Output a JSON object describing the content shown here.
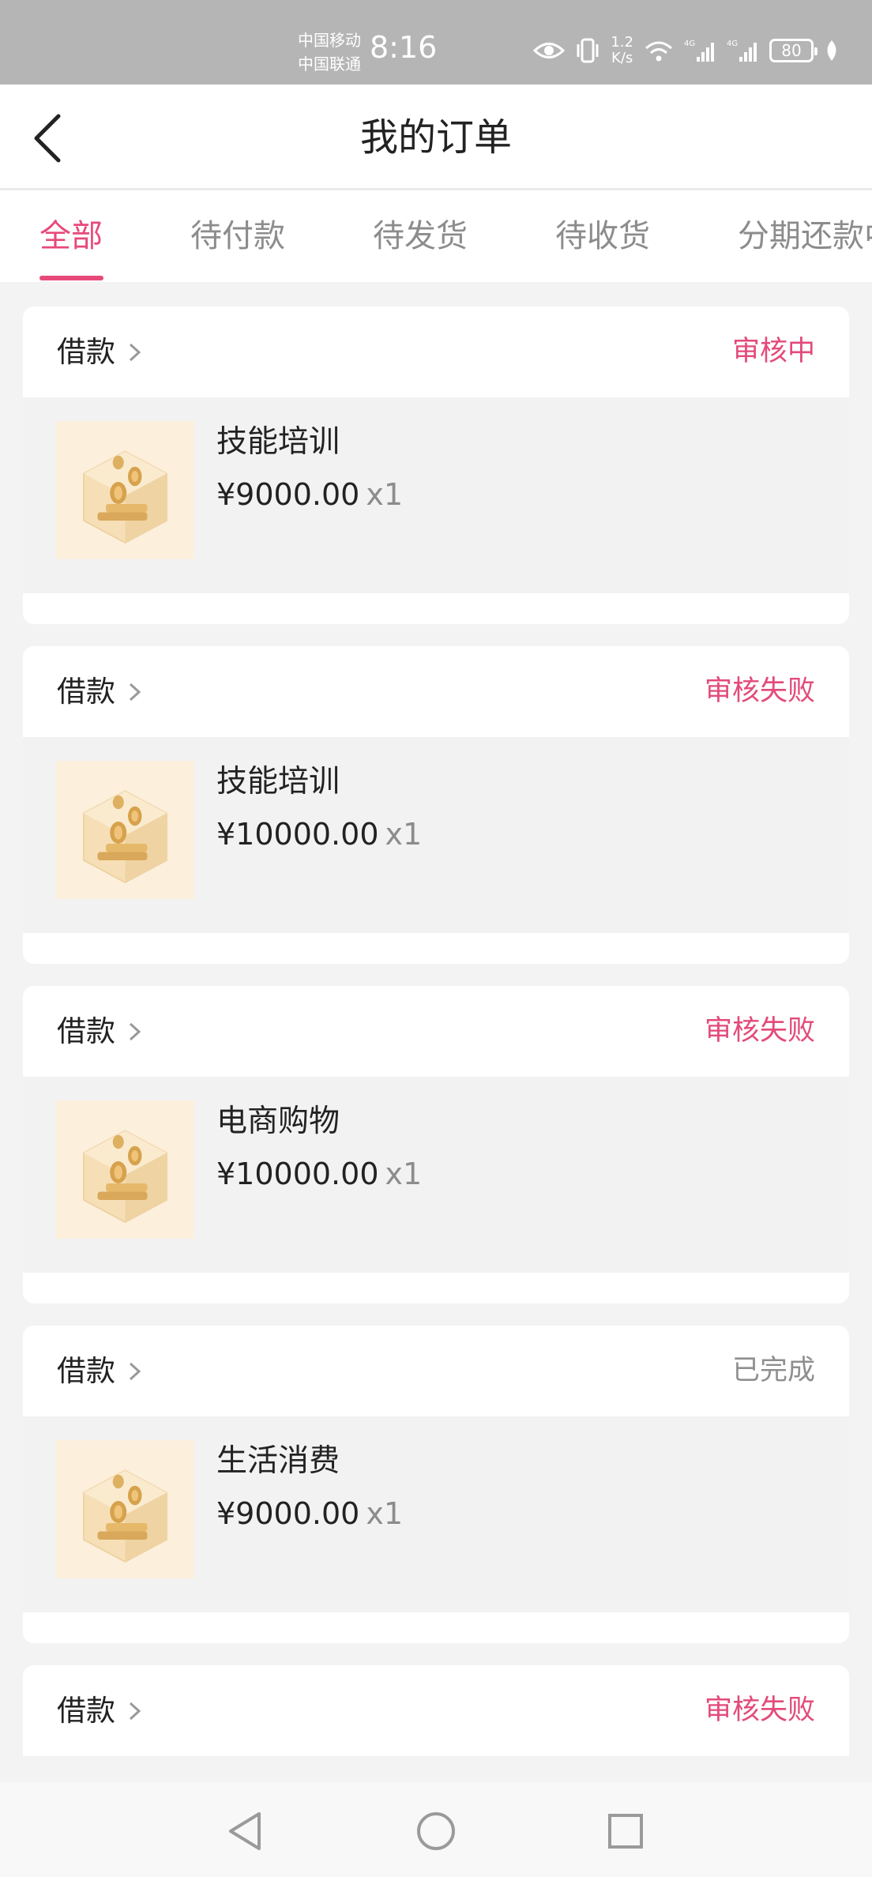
{
  "status_bar": {
    "carrier_1": "中国移动",
    "carrier_2": "中国联通",
    "time": "8:16",
    "net_speed_value": "1.2",
    "net_speed_unit": "K/s",
    "battery": "80",
    "icons": [
      "eye-icon",
      "vibrate-icon",
      "wifi-icon",
      "signal-4g-icon",
      "signal-4g-icon",
      "battery-icon",
      "leaf-icon"
    ]
  },
  "nav": {
    "title": "我的订单",
    "back_icon": "back-arrow-icon"
  },
  "tabs": [
    {
      "label": "全部",
      "active": true
    },
    {
      "label": "待付款",
      "active": false
    },
    {
      "label": "待发货",
      "active": false
    },
    {
      "label": "待收货",
      "active": false
    },
    {
      "label": "分期还款中",
      "active": false
    }
  ],
  "orders": [
    {
      "type": "借款",
      "status": "审核中",
      "product": "技能培训",
      "price": "¥9000.00",
      "qty": "x1"
    },
    {
      "type": "借款",
      "status": "审核失败",
      "product": "技能培训",
      "price": "¥10000.00",
      "qty": "x1"
    },
    {
      "type": "借款",
      "status": "审核失败",
      "product": "电商购物",
      "price": "¥10000.00",
      "qty": "x1"
    },
    {
      "type": "借款",
      "status": "已完成",
      "product": "生活消费",
      "price": "¥9000.00",
      "qty": "x1"
    },
    {
      "type": "借款",
      "status": "审核失败"
    }
  ],
  "colors": {
    "accent": "#e74a7a",
    "status_done": "#8f8f8f",
    "page_bg": "#f3f3f3",
    "status_bar_bg": "#b5b5b5"
  },
  "system_nav": {
    "icons": [
      "back-triangle-icon",
      "home-circle-icon",
      "recents-square-icon"
    ]
  }
}
